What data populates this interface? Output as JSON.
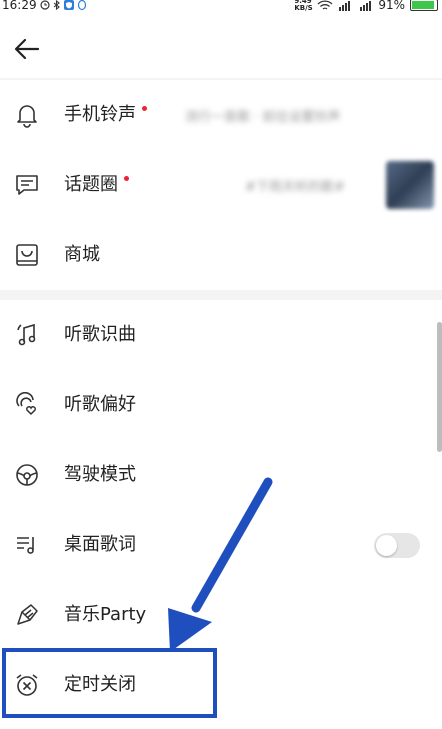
{
  "status_bar": {
    "time": "16:29",
    "net_speed": "9.49 KB/S",
    "battery": "91%",
    "icons": [
      "alarm-icon",
      "bluetooth-icon",
      "shield-icon",
      "qq-icon",
      "wifi-icon",
      "signal-icon",
      "battery-icon"
    ]
  },
  "nav": {
    "back_icon": "arrow-left-icon"
  },
  "group1": [
    {
      "key": "ringtone",
      "label": "手机铃声",
      "icon": "bell-icon",
      "dot": true,
      "subtitle": "流行一首歌 · 前往设置铃声"
    },
    {
      "key": "topics",
      "label": "话题圈",
      "icon": "chat-bubble-icon",
      "dot": true,
      "subtitle": "#下雨天听的歌#"
    },
    {
      "key": "mall",
      "label": "商城",
      "icon": "shopping-bag-icon",
      "dot": false
    }
  ],
  "group2": [
    {
      "key": "recognize",
      "label": "听歌识曲",
      "icon": "music-note-icon"
    },
    {
      "key": "preference",
      "label": "听歌偏好",
      "icon": "ear-heart-icon"
    },
    {
      "key": "driving",
      "label": "驾驶模式",
      "icon": "steering-wheel-icon"
    },
    {
      "key": "lyrics",
      "label": "桌面歌词",
      "icon": "lyrics-icon",
      "toggle": false
    },
    {
      "key": "party",
      "label": "音乐Party",
      "icon": "party-horn-icon"
    },
    {
      "key": "timer",
      "label": "定时关闭",
      "icon": "alarm-clock-x-icon"
    }
  ],
  "colors": {
    "highlight": "#1f4fbf",
    "dot": "#e22233",
    "battery": "#3ec64a"
  }
}
